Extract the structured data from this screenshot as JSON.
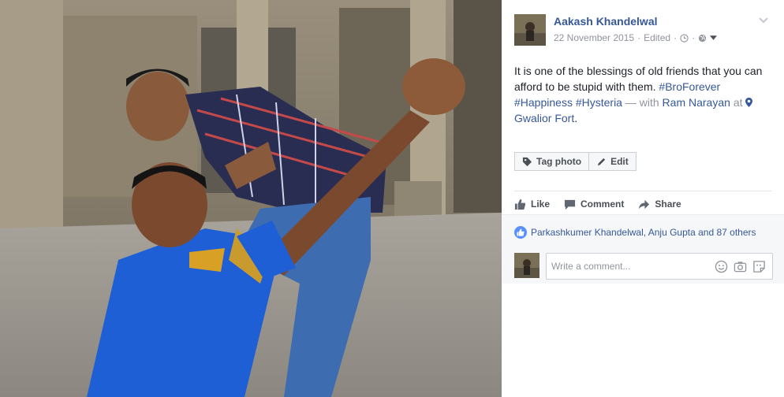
{
  "photo": {
    "description_icon": "photo-of-two-friends-at-fort"
  },
  "post": {
    "author": "Aakash Khandelwal",
    "date": "22 November 2015",
    "edited": "Edited",
    "text_main": "It is one of the blessings of old friends that you can afford to be stupid with them.",
    "hashtags": [
      "#BroForever",
      "#Happiness",
      "#Hysteria"
    ],
    "with_label": "— with",
    "with_person": "Ram Narayan",
    "at_label": "at",
    "location": "Gwalior Fort",
    "location_suffix": "."
  },
  "photo_actions": {
    "tag_label": "Tag photo",
    "edit_label": "Edit"
  },
  "actions": {
    "like": "Like",
    "comment": "Comment",
    "share": "Share"
  },
  "reactions": {
    "likes_text": "Parkashkumer Khandelwal, Anju Gupta and 87 others"
  },
  "comment_box": {
    "placeholder": "Write a comment..."
  },
  "colors": {
    "link": "#365899",
    "text": "#1d2129",
    "muted": "#90949c",
    "like_blue": "#5890ff"
  }
}
